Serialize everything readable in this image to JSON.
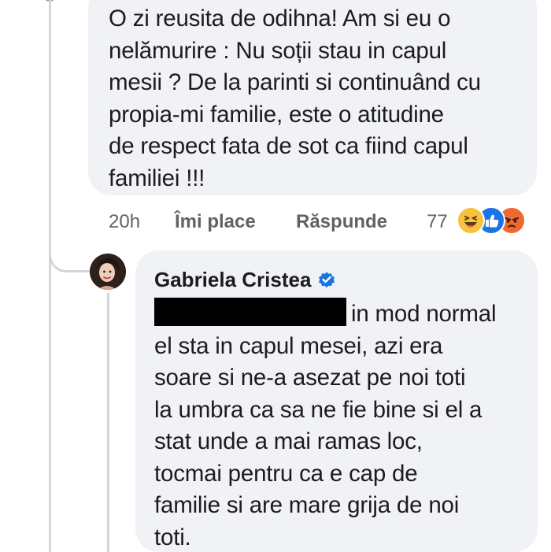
{
  "comment": {
    "text": "O zi reusita de odihna! Am si eu o\nnelămurire : Nu soții stau in capul\nmesii ? De la parinti si continuând cu\npropia-mi familie, este o atitudine\nde respect fata de sot ca fiind capul\nfamiliei !!!",
    "time": "20h",
    "like_label": "Îmi place",
    "reply_label": "Răspunde",
    "reaction_count": "77",
    "reactions": [
      "haha-reaction-icon",
      "like-reaction-icon",
      "angry-reaction-icon"
    ],
    "colors": {
      "haha": "#f7c23d",
      "like": "#1b74e4",
      "angry": "#ee6930"
    }
  },
  "reply": {
    "author": "Gabriela Cristea",
    "verified_icon": "verified-badge-icon",
    "first_line_text": "in mod normal",
    "text": "el sta in capul mesei, azi era\nsoare si ne-a asezat pe noi toti\nla umbra ca sa ne fie bine si el a\nstat unde a mai ramas loc,\ntocmai pentru ca e cap de\nfamilie si are mare grija de noi\ntoti."
  },
  "colors": {
    "bubble_bg": "#f0f2f5",
    "text": "#1c1c1c",
    "meta_text": "#5f6368",
    "thread_line": "#d3d6da",
    "verified": "#1b74e4"
  }
}
